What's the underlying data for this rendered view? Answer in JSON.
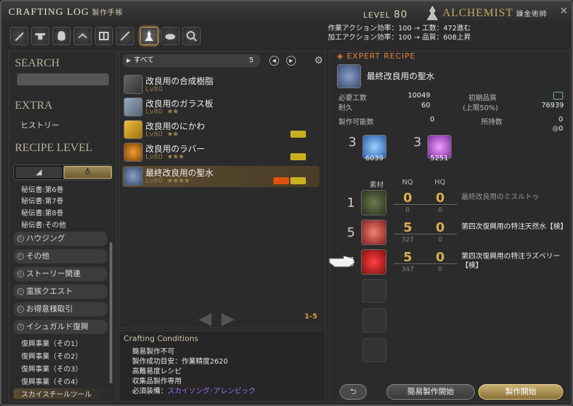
{
  "window": {
    "title": "CRAFTING LOG",
    "title_jp": "製作手帳",
    "level_label": "LEVEL",
    "level_value": "80",
    "job_name": "ALCHEMIST",
    "job_name_jp": "錬金術師",
    "stat_line1": "作業アクション効率：100 → 工数：472進む",
    "stat_line2": "加工アクション効率：100 → 品質：608上昇"
  },
  "toolbar": {
    "icons": [
      "carpenter-icon",
      "blacksmith-icon",
      "armorer-icon",
      "goldsmith-icon",
      "leatherworker-icon",
      "weaver-icon",
      "alchemist-icon",
      "culinarian-icon",
      "search-icon"
    ],
    "active_index": 6
  },
  "left": {
    "search_label": "SEARCH",
    "extra_label": "EXTRA",
    "history_label": "ヒストリー",
    "recipe_level_label": "RECIPE LEVEL",
    "book_items": [
      "秘伝書:第6巻",
      "秘伝書:第7巻",
      "秘伝書:第8巻",
      "秘伝書:その他"
    ],
    "categories": [
      "ハウジング",
      "その他",
      "ストーリー関連",
      "蛮族クエスト",
      "お得意様取引",
      "イシュガルド復興"
    ],
    "sub_items": [
      "復興事業（その1）",
      "復興事業（その2）",
      "復興事業（その3）",
      "復興事業（その4）",
      "スカイスチールツール"
    ]
  },
  "middle": {
    "filter_label": "すべて",
    "filter_count": "5",
    "recipes": [
      {
        "name": "改良用の合成樹脂",
        "level": "Lv80",
        "stars": ""
      },
      {
        "name": "改良用のガラス板",
        "level": "Lv80",
        "stars": "★★"
      },
      {
        "name": "改良用のにかわ",
        "level": "Lv80",
        "stars": "★★"
      },
      {
        "name": "改良用のラバー",
        "level": "Lv80",
        "stars": "★★★"
      },
      {
        "name": "最終改良用の聖水",
        "level": "Lv80",
        "stars": "★★★★"
      }
    ],
    "page_count": "1-5"
  },
  "conditions": {
    "header": "Crafting Conditions",
    "lines": [
      "簡易製作不可",
      "製作成功目安：作業精度2620",
      "高難易度レシピ",
      "収集品製作専用"
    ],
    "equip_label": "必須装備：",
    "equip_value": "スカイソング･アレンビック"
  },
  "right": {
    "expert_label": "EXPERT RECIPE",
    "item_name": "最終改良用の聖水",
    "difficulty_label": "必要工数",
    "difficulty_value": "10049",
    "durability_label": "耐久",
    "durability_value": "60",
    "quality_label": "初期品質",
    "quality_cap": "(上限50%)",
    "quality_value": "76939",
    "craftable_label": "製作可能数",
    "craftable_value": "0",
    "owned_label": "所持数",
    "owned_value": "0",
    "owned_hq": "0",
    "crystals": [
      {
        "count": "3",
        "owned": "6039",
        "color": "#4a8ae8"
      },
      {
        "count": "3",
        "owned": "5251",
        "color": "#c060e0"
      }
    ],
    "col_material": "素材",
    "col_nq": "NQ",
    "col_hq": "HQ",
    "materials": [
      {
        "count": "1",
        "nq": "0",
        "hq": "0",
        "nq_have": "0",
        "hq_have": "0",
        "name": "最終改良用のミスルトゥ",
        "dim": true
      },
      {
        "count": "5",
        "nq": "5",
        "hq": "0",
        "nq_have": "327",
        "hq_have": "0",
        "name": "第四次復興用の特注天然水【検】",
        "dim": false
      },
      {
        "count": "5",
        "nq": "5",
        "hq": "0",
        "nq_have": "347",
        "hq_have": "0",
        "name": "第四次復興用の特注ラズベリー【検】",
        "dim": false
      }
    ],
    "quick_synth_label": "簡易製作開始",
    "synth_label": "製作開始"
  }
}
